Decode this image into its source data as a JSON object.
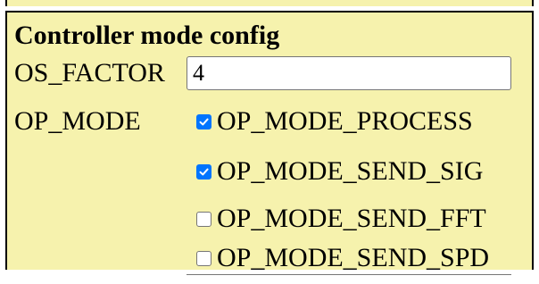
{
  "panel": {
    "title": "Controller mode config"
  },
  "os_factor": {
    "label": "OS_FACTOR",
    "value": "4"
  },
  "op_mode": {
    "label": "OP_MODE",
    "options": [
      {
        "label": "OP_MODE_PROCESS",
        "checked": true
      },
      {
        "label": "OP_MODE_SEND_SIG",
        "checked": true
      },
      {
        "label": "OP_MODE_SEND_FFT",
        "checked": false
      },
      {
        "label": "OP_MODE_SEND_SPD",
        "checked": false
      }
    ]
  },
  "colors": {
    "panel_background": "#f6f2ad",
    "checkbox_checked": "#0075ff",
    "border": "#000000"
  }
}
